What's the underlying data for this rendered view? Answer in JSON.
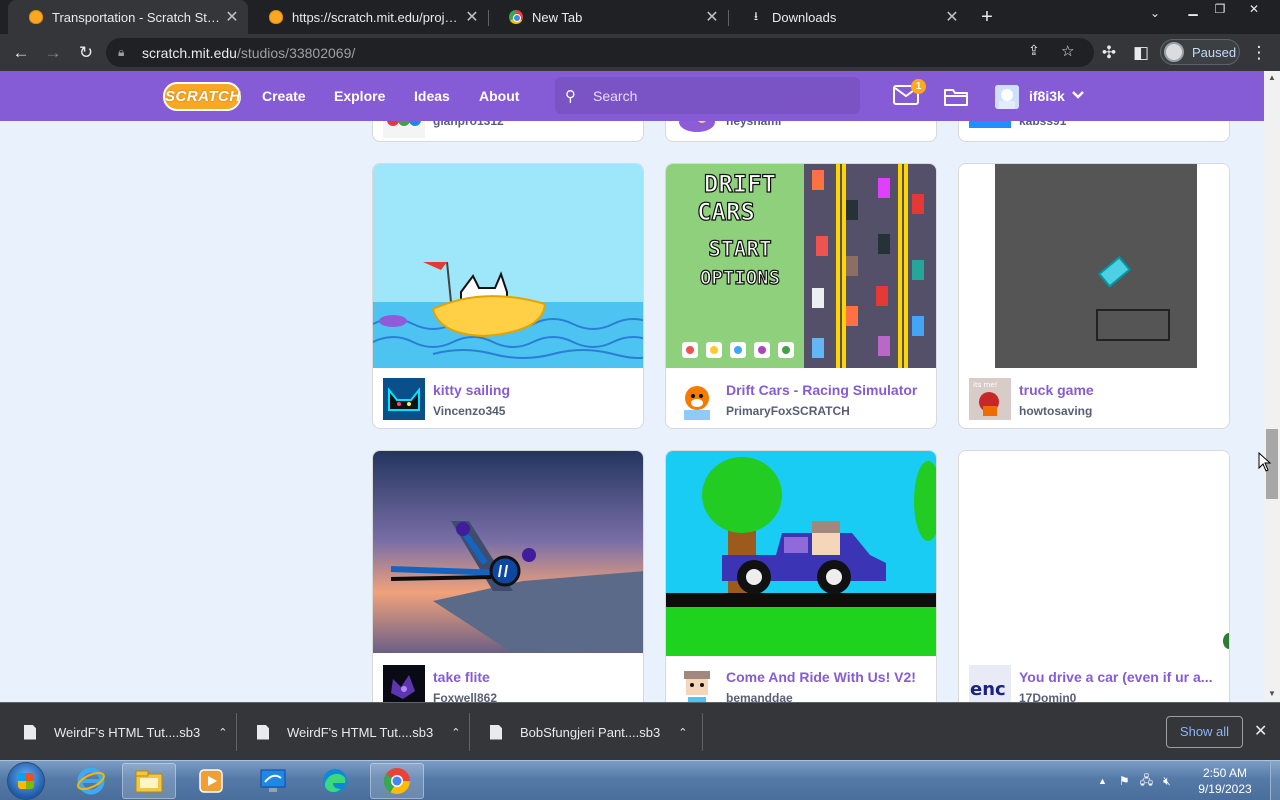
{
  "browser": {
    "tabs": [
      {
        "title": "Transportation - Scratch Studio",
        "active": true
      },
      {
        "title": "https://scratch.mit.edu/projects/t",
        "active": false
      },
      {
        "title": "New Tab",
        "active": false
      },
      {
        "title": "Downloads",
        "active": false
      }
    ],
    "url_host": "scratch.mit.edu",
    "url_path": "/studios/33802069/",
    "profile_status": "Paused"
  },
  "scratch_nav": {
    "logo_text": "SCRATCH",
    "links": [
      "Create",
      "Explore",
      "Ideas",
      "About"
    ],
    "search_placeholder": "Search",
    "message_count": "1",
    "username": "if8i3k"
  },
  "projects": [
    {
      "title": "",
      "owner": "gianpro1312"
    },
    {
      "title": "",
      "owner": "heyshami"
    },
    {
      "title": "",
      "owner": "kabss91"
    },
    {
      "title": "kitty sailing",
      "owner": "Vincenzo345"
    },
    {
      "title": "Drift Cars - Racing Simulator",
      "owner": "PrimaryFoxSCRATCH"
    },
    {
      "title": "truck game",
      "owner": "howtosaving"
    },
    {
      "title": "take flite",
      "owner": "Foxwell862"
    },
    {
      "title": "Come And Ride With Us! V2!",
      "owner": "bemanddae"
    },
    {
      "title": "You drive a car (even if ur a...",
      "owner": "17Domin0"
    }
  ],
  "thumb_text": {
    "drift_line1": "DRIFT",
    "drift_line2": "CARS",
    "drift_start": "START",
    "drift_options": "OPTIONS",
    "truck_avatar_text": "its me!",
    "you_drive_avatar_text": "enc"
  },
  "downloads": [
    {
      "name": "WeirdF's HTML Tut....sb3"
    },
    {
      "name": "WeirdF's HTML Tut....sb3"
    },
    {
      "name": "BobSfungjeri Pant....sb3"
    }
  ],
  "downloads_show_all": "Show all",
  "taskbar": {
    "time": "2:50 AM",
    "date": "9/19/2023"
  },
  "colors": {
    "scratch_purple": "#855cd6",
    "scratch_orange": "#ffab19",
    "chrome_dark": "#202124"
  }
}
